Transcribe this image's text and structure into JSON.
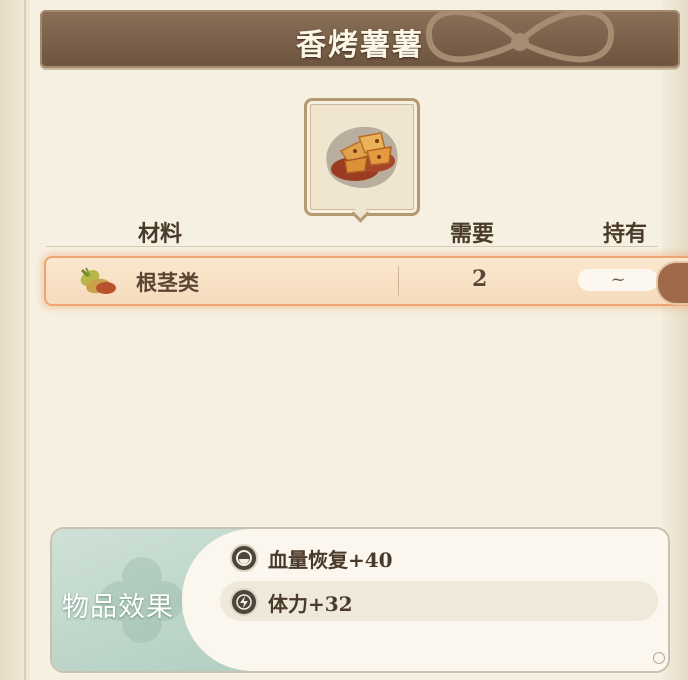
{
  "title": "香烤薯薯",
  "headers": {
    "material": "材料",
    "need": "需要",
    "have": "持有"
  },
  "materials": [
    {
      "name": "根茎类",
      "need": "2",
      "have": "~",
      "icon": "root-vegetable-icon"
    }
  ],
  "effects": {
    "title": "物品效果",
    "items": [
      {
        "icon": "heart-restore-icon",
        "text": "血量恢复+40"
      },
      {
        "icon": "stamina-bolt-icon",
        "text": "体力+32"
      }
    ]
  },
  "colors": {
    "title_bar": "#6c5440",
    "row_highlight": "#f0a46e",
    "effect_accent": "#b2cfc1"
  }
}
